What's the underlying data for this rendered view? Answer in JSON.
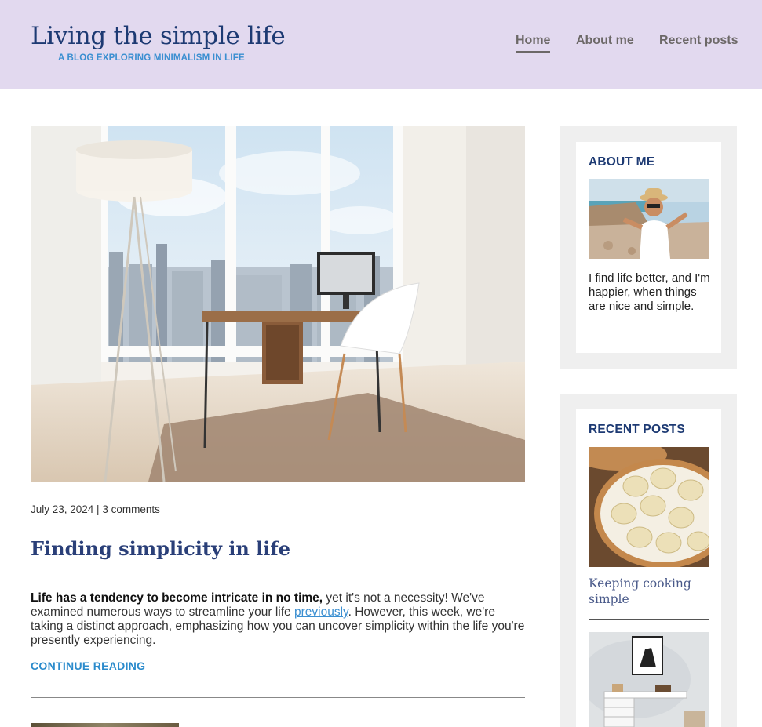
{
  "header": {
    "title": "Living the simple life",
    "tagline": "A BLOG EXPLORING MINIMALISM IN LIFE",
    "nav": [
      {
        "label": "Home",
        "active": true
      },
      {
        "label": "About me",
        "active": false
      },
      {
        "label": "Recent posts",
        "active": false
      }
    ]
  },
  "post": {
    "image": "minimal-home-office-photo",
    "meta": "July 23, 2024 | 3 comments",
    "title": "Finding simplicity in life",
    "excerpt": {
      "lead_bold": "Life has a tendency to become intricate in no time,",
      "text_before_link": " yet it's not a necessity! We've examined numerous ways to streamline your life ",
      "link_text": "previously",
      "text_after_link": ". However, this week, we're taking a distinct approach, emphasizing how you can uncover simplicity within the life you're presently experiencing."
    },
    "continue_label": "CONTINUE READING"
  },
  "sidebar": {
    "about": {
      "heading": "ABOUT ME",
      "image": "traveler-selfie-photo",
      "text": "I find life better, and I'm happier, when things are nice and simple."
    },
    "recent": {
      "heading": "RECENT POSTS",
      "items": [
        {
          "title": "Keeping cooking simple",
          "image": "dumplings-photo"
        },
        {
          "image": "white-desk-photo"
        }
      ]
    }
  },
  "colors": {
    "header_bg": "#e2d9ef",
    "title": "#1d3a73",
    "accent": "#3b8fd1",
    "nav_text": "#6c6867",
    "widget_bg": "#efefef"
  }
}
